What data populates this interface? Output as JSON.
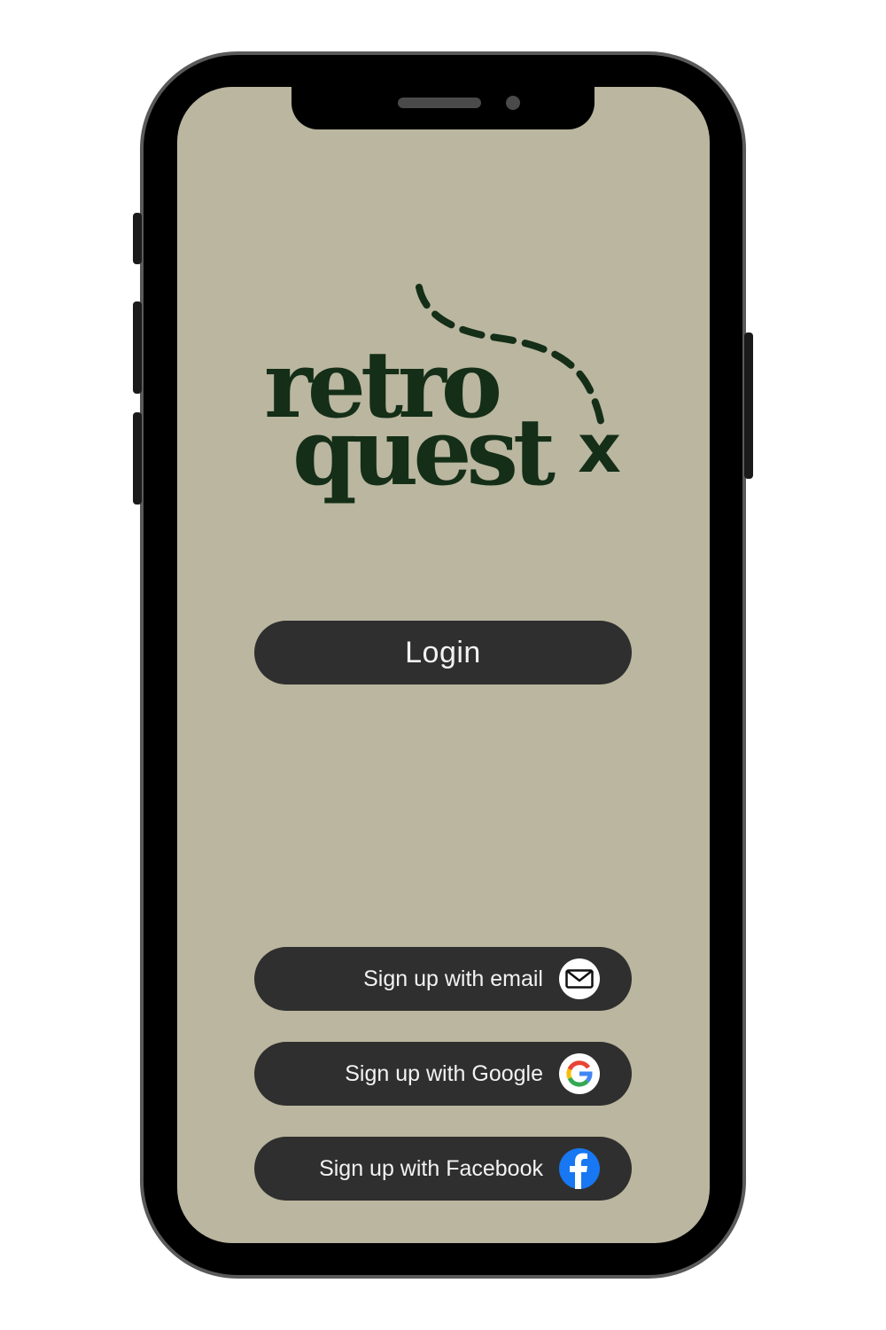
{
  "app": {
    "logo": {
      "line1": "retro",
      "line2": "quest",
      "mark": "x",
      "color": "#142e17"
    },
    "colors": {
      "screen_bg": "#bab69f",
      "button_bg": "#2f2f2f",
      "button_text": "#f2f2f2"
    }
  },
  "actions": {
    "login_label": "Login",
    "signup_email_label": "Sign up with email",
    "signup_google_label": "Sign up with Google",
    "signup_facebook_label": "Sign up with Facebook"
  },
  "icons": {
    "email": "envelope-icon",
    "google": "google-icon",
    "facebook": "facebook-icon"
  }
}
